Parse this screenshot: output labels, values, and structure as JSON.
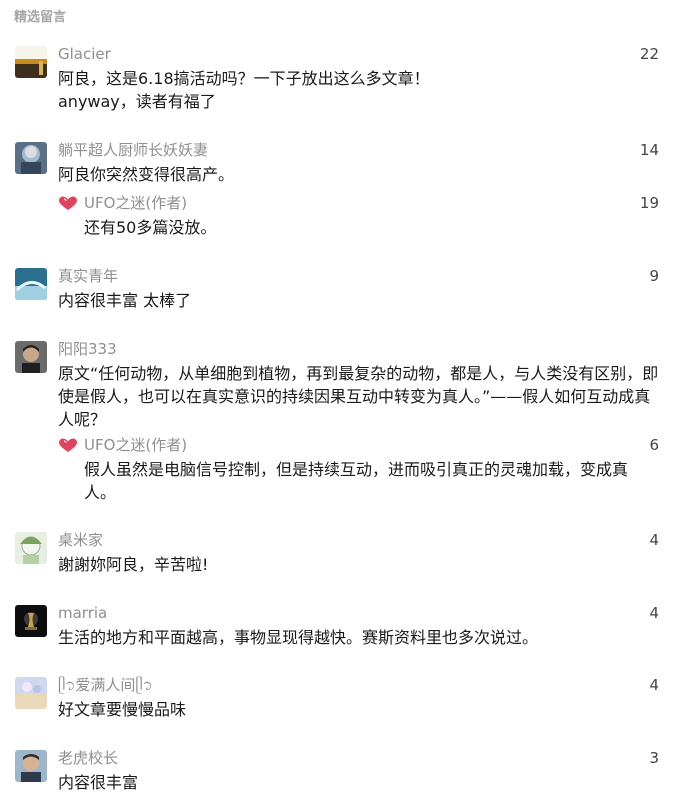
{
  "section_title": "精选留言",
  "comments": [
    {
      "name": "Glacier",
      "likes": "22",
      "text": "阿良，这是6.18搞活动吗？一下子放出这么多文章！\nanyway，读者有福了"
    },
    {
      "name": "躺平超人厨师长妖妖妻",
      "likes": "14",
      "text": "阿良你突然变得很高产。",
      "reply": {
        "name": "UFO之迷(作者)",
        "likes": "19",
        "text": "还有50多篇没放。"
      }
    },
    {
      "name": "真实青年",
      "likes": "9",
      "text": "内容很丰富 太棒了"
    },
    {
      "name": "阳阳333",
      "likes": "",
      "text": "原文“任何动物，从单细胞到植物，再到最复杂的动物，都是人，与人类没有区别，即使是假人，也可以在真实意识的持续因果互动中转变为真人。”——假人如何互动成真人呢？",
      "reply": {
        "name": "UFO之迷(作者)",
        "likes": "6",
        "text": "假人虽然是电脑信号控制，但是持续互动，进而吸引真正的灵魂加载，变成真人。"
      }
    },
    {
      "name": "桌米家",
      "likes": "4",
      "text": "謝謝妳阿良，辛苦啦!"
    },
    {
      "name": "marria",
      "likes": "4",
      "text": "生活的地方和平面越高，事物显现得越快。赛斯资料里也多次说过。"
    },
    {
      "name": "ᥫ᭡爱满人间ᥫ᭡",
      "likes": "4",
      "text": "好文章要慢慢品味"
    },
    {
      "name": "老虎校长",
      "likes": "3",
      "text": "内容很丰富"
    }
  ]
}
